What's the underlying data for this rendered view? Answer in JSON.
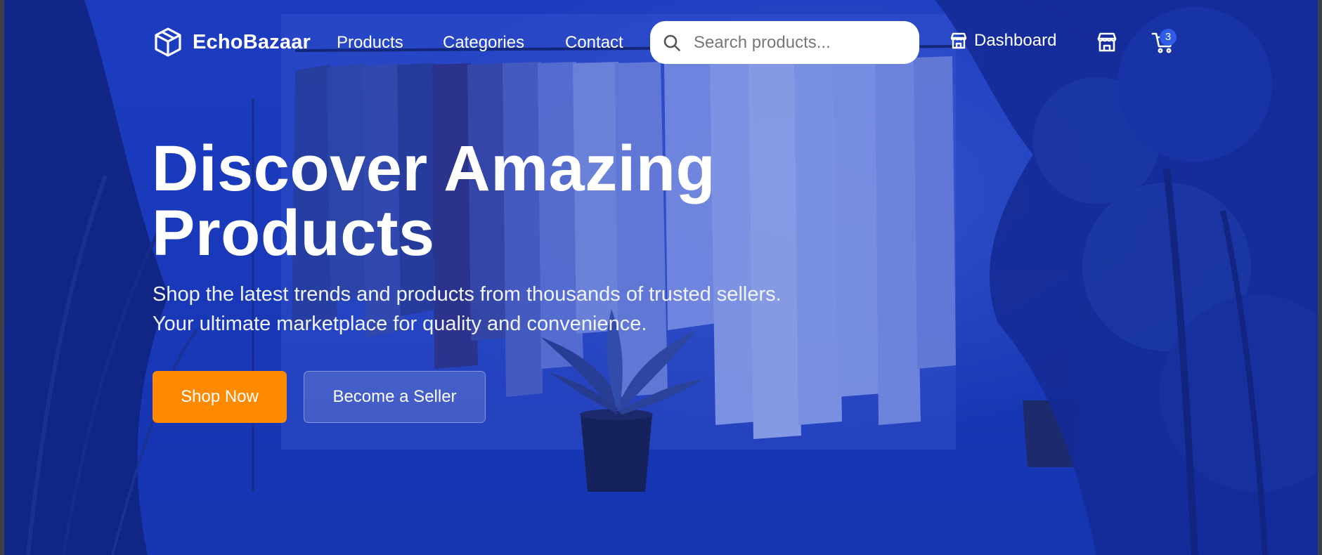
{
  "brand": {
    "name": "EchoBazaar",
    "icon": "cube-icon"
  },
  "nav": {
    "links": [
      {
        "label": "Products"
      },
      {
        "label": "Categories"
      },
      {
        "label": "Contact"
      }
    ]
  },
  "search": {
    "placeholder": "Search products...",
    "value": "",
    "icon": "search-icon"
  },
  "actions": {
    "dashboard_label": "Dashboard",
    "dashboard_icon": "store-icon",
    "store_icon": "store-icon",
    "cart_icon": "cart-icon",
    "cart_count": "3"
  },
  "hero": {
    "headline_line1": "Discover Amazing",
    "headline_line2": "Products",
    "subtitle_line1": "Shop the latest trends and products from thousands of trusted sellers.",
    "subtitle_line2": "Your ultimate marketplace for quality and convenience.",
    "primary_cta": "Shop Now",
    "secondary_cta": "Become a Seller"
  },
  "colors": {
    "overlay": "#1d3dc1",
    "primary_button": "#ff8a00",
    "cart_badge": "#2f5be6",
    "text": "#ffffff"
  }
}
